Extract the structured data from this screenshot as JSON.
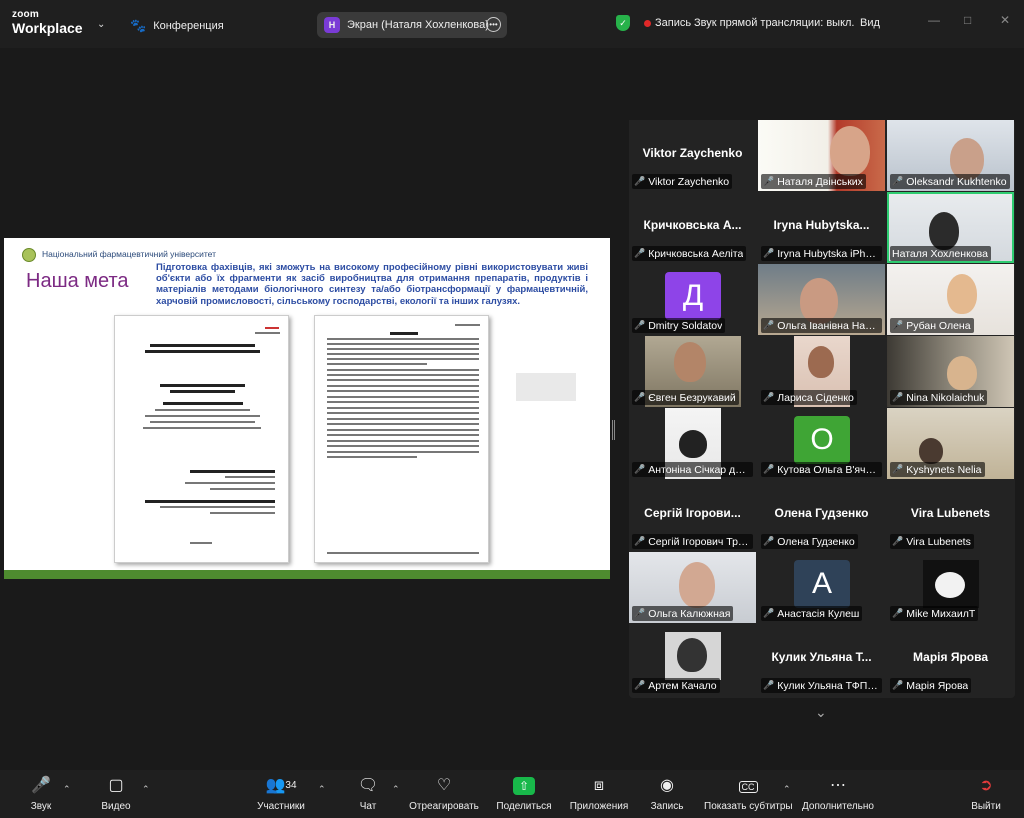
{
  "topbar": {
    "logo_line1": "zoom",
    "logo_line2": "Workplace",
    "conference_label": "Конференция",
    "share_badge": "Н",
    "share_label": "Экран (Наталя Хохленкова)",
    "recording_label": "Запись",
    "live_label": "Звук прямой трансляции: выкл.",
    "view_label": "Вид"
  },
  "slide": {
    "university": "Національний фармацевтичний університет",
    "heading": "Наша мета",
    "text": "Підготовка фахівців, які зможуть на високому професійному рівні використовувати живі об'єкти або їх фрагменти як засіб виробництва для отримання препаратів, продуктів і матеріалів методами біологічного синтезу та/або біотрансформації у фармацевтичній, харчовій промисловості, сільському господарстві, екології та інших галузях."
  },
  "participants": [
    {
      "display": "Viktor Zaychenko",
      "label": "Viktor Zaychenko",
      "type": "name"
    },
    {
      "display": "",
      "label": "Наталя Двінських",
      "type": "video"
    },
    {
      "display": "",
      "label": "Oleksandr Kukhtenko",
      "type": "video"
    },
    {
      "display": "Кричковська А...",
      "label": "Кричковська Аеліта",
      "type": "name"
    },
    {
      "display": "Iryna Hubytska...",
      "label": "Iryna Hubytska iPhon...",
      "type": "name"
    },
    {
      "display": "",
      "label": "Наталя Хохленкова",
      "type": "video",
      "active": true
    },
    {
      "display": "Д",
      "label": "Dmitry Soldatov",
      "type": "letter",
      "color": "#8e44e8"
    },
    {
      "display": "",
      "label": "Ольга Іванівна Набо...",
      "type": "video"
    },
    {
      "display": "",
      "label": "Рубан Олена",
      "type": "video"
    },
    {
      "display": "",
      "label": "Євген Безрукавий",
      "type": "video"
    },
    {
      "display": "",
      "label": "Лариса Сіденко",
      "type": "video"
    },
    {
      "display": "",
      "label": "Nina Nikolaichuk",
      "type": "video"
    },
    {
      "display": "",
      "label": "Антоніна Січкар доц...",
      "type": "video"
    },
    {
      "display": "О",
      "label": "Кутова Ольга В'ячес...",
      "type": "letter",
      "color": "#3fa535"
    },
    {
      "display": "",
      "label": "Kyshynets Nelia",
      "type": "video"
    },
    {
      "display": "Сергій Ігорови...",
      "label": "Сергій Ігорович Трут...",
      "type": "name"
    },
    {
      "display": "Олена Гудзенко",
      "label": "Олена Гудзенко",
      "type": "name"
    },
    {
      "display": "Vira Lubenets",
      "label": "Vira Lubenets",
      "type": "name"
    },
    {
      "display": "",
      "label": "Ольга Калюжная",
      "type": "video"
    },
    {
      "display": "А",
      "label": "Анастасія Кулеш",
      "type": "letter",
      "color": "#2f4258"
    },
    {
      "display": "",
      "label": "Mike МихаилТ",
      "type": "video"
    },
    {
      "display": "",
      "label": "Артем Качало",
      "type": "video"
    },
    {
      "display": "Кулик Ульяна Т...",
      "label": "Кулик Ульяна ТФПм2...",
      "type": "name"
    },
    {
      "display": "Марія Ярова",
      "label": "Марія Ярова",
      "type": "name"
    }
  ],
  "toolbar": {
    "audio": "Звук",
    "video": "Видео",
    "participants": "Участники",
    "participants_count": "34",
    "chat": "Чат",
    "react": "Отреагировать",
    "share": "Поделиться",
    "apps": "Приложения",
    "record": "Запись",
    "captions": "Показать субтитры",
    "more": "Дополнительно",
    "leave": "Выйти"
  }
}
